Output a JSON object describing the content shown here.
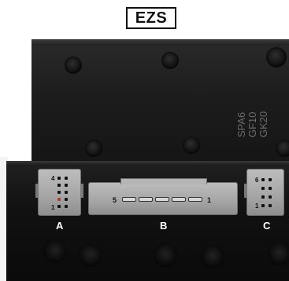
{
  "title": "EZS",
  "part_marking": [
    "SPA6",
    "GF10",
    "GK20"
  ],
  "connectors": [
    {
      "id": "A",
      "label": "A"
    },
    {
      "id": "B",
      "label": "B",
      "pin_first": "5",
      "pin_last": "1"
    },
    {
      "id": "C",
      "label": "C"
    }
  ],
  "colors": {
    "housing": "#1c1c1c",
    "connector": "#a5a5a5",
    "label_text": "#ffffff"
  }
}
